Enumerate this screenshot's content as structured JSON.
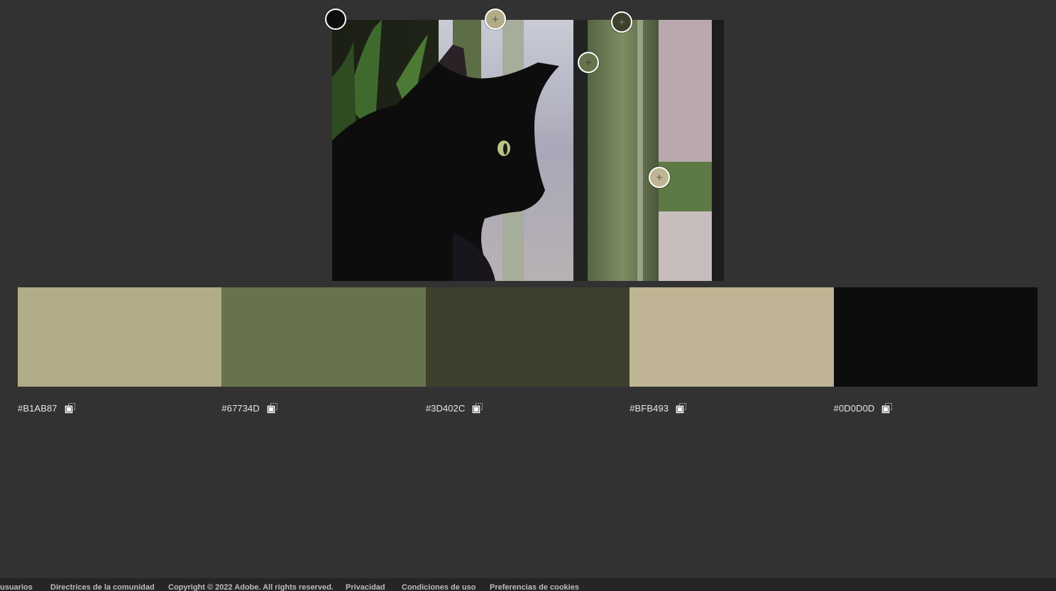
{
  "image": {
    "description_icon": "photo-black-cat-window"
  },
  "pickers": [
    {
      "name": "color-picker-1",
      "color": "#0D0D0D",
      "has_plus": false
    },
    {
      "name": "color-picker-2",
      "color": "#B1AB87",
      "has_plus": true
    },
    {
      "name": "color-picker-3",
      "color": "#3D402C",
      "has_plus": true
    },
    {
      "name": "color-picker-4",
      "color": "#67734D",
      "has_plus": true
    },
    {
      "name": "color-picker-5",
      "color": "#BFB493",
      "has_plus": true
    }
  ],
  "swatches": [
    {
      "hex": "#B1AB87",
      "color": "#B1AB87"
    },
    {
      "hex": "#67734D",
      "color": "#67734D"
    },
    {
      "hex": "#3D402C",
      "color": "#3D402C"
    },
    {
      "hex": "#BFB493",
      "color": "#BFB493"
    },
    {
      "hex": "#0D0D0D",
      "color": "#0D0D0D"
    }
  ],
  "copy_icon": "copy-icon",
  "footer": {
    "links": [
      "usuarios",
      "Directrices de la comunidad",
      "Copyright © 2022 Adobe. All rights reserved.",
      "Privacidad",
      "Condiciones de uso",
      "Preferencias de cookies"
    ]
  }
}
